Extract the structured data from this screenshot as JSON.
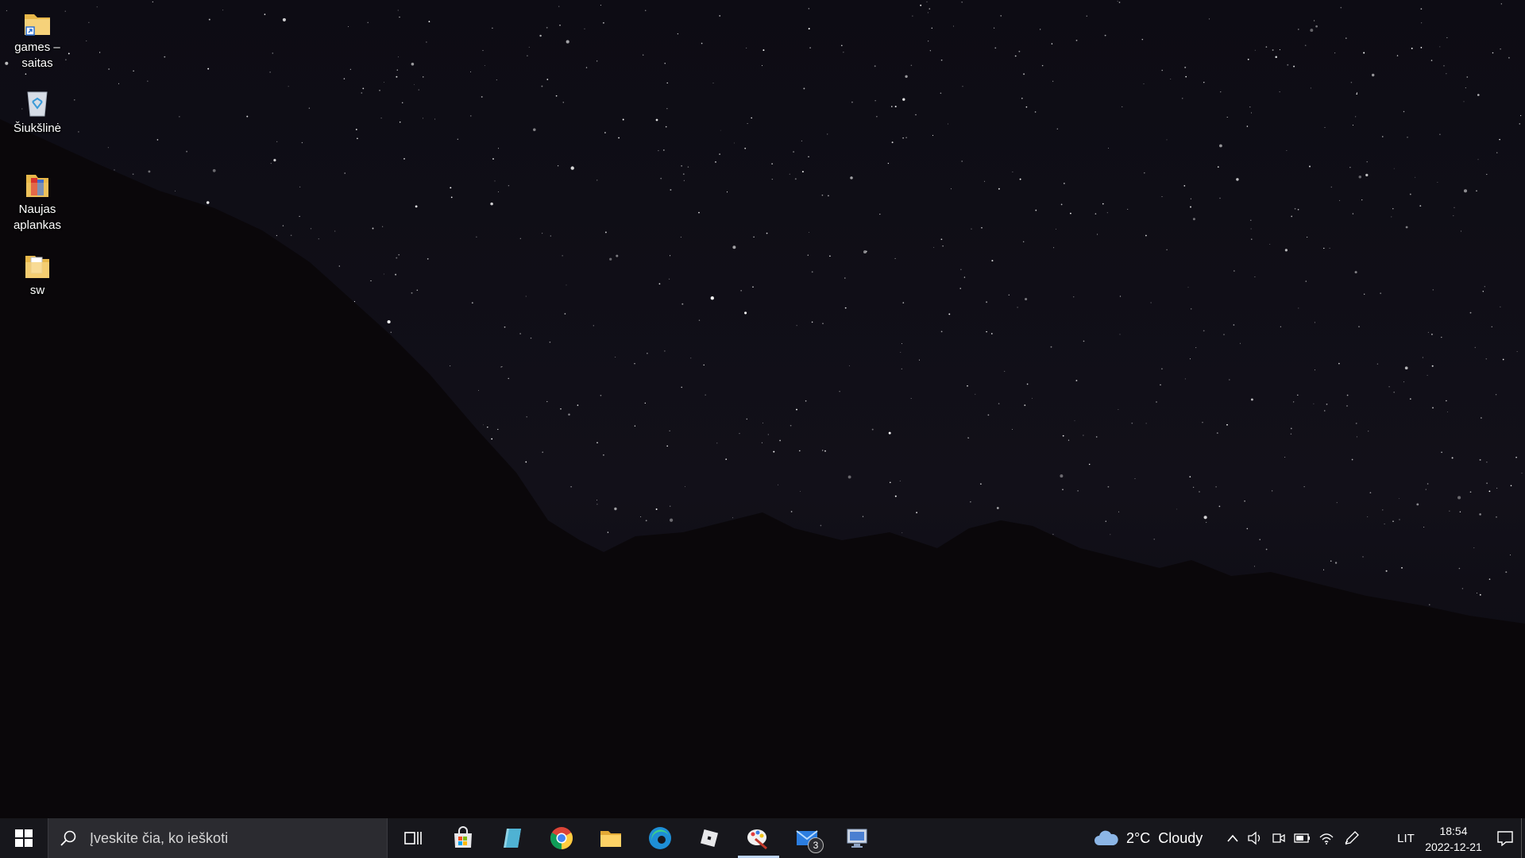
{
  "desktop": {
    "icons": [
      {
        "label": "games –\nsaitas",
        "icon": "folder-shortcut-icon"
      },
      {
        "label": "Šiukšlinė",
        "icon": "recycle-bin-icon"
      },
      {
        "label": "Naujas\naplankas",
        "icon": "folder-red-icon"
      },
      {
        "label": "sw",
        "icon": "folder-icon"
      }
    ]
  },
  "taskbar": {
    "search_placeholder": "Įveskite čia, ko ieškoti",
    "apps": [
      {
        "name": "task-view",
        "icon": "task-view-icon"
      },
      {
        "name": "microsoft-store",
        "icon": "store-icon"
      },
      {
        "name": "notepad-app",
        "icon": "notepad-icon"
      },
      {
        "name": "chrome",
        "icon": "chrome-icon"
      },
      {
        "name": "file-explorer",
        "icon": "folder-icon"
      },
      {
        "name": "edge",
        "icon": "edge-icon"
      },
      {
        "name": "roblox",
        "icon": "roblox-icon"
      },
      {
        "name": "paint-app",
        "icon": "paint-icon"
      },
      {
        "name": "mail",
        "icon": "mail-icon",
        "badge": "3"
      },
      {
        "name": "remote-desktop",
        "icon": "monitor-icon"
      }
    ],
    "weather": {
      "temp": "2°C",
      "condition": "Cloudy",
      "icon": "cloud-icon"
    },
    "tray_icons": [
      "chevron-up-icon",
      "volume-icon",
      "meet-now-icon",
      "battery-icon",
      "wifi-icon",
      "pen-icon"
    ],
    "language": "LIT",
    "clock": {
      "time": "18:54",
      "date": "2022-12-21"
    },
    "colors": {
      "taskbar_bg": "#17171c",
      "search_bg": "#2b2b30",
      "active_underline": "#bcd3f0"
    }
  }
}
